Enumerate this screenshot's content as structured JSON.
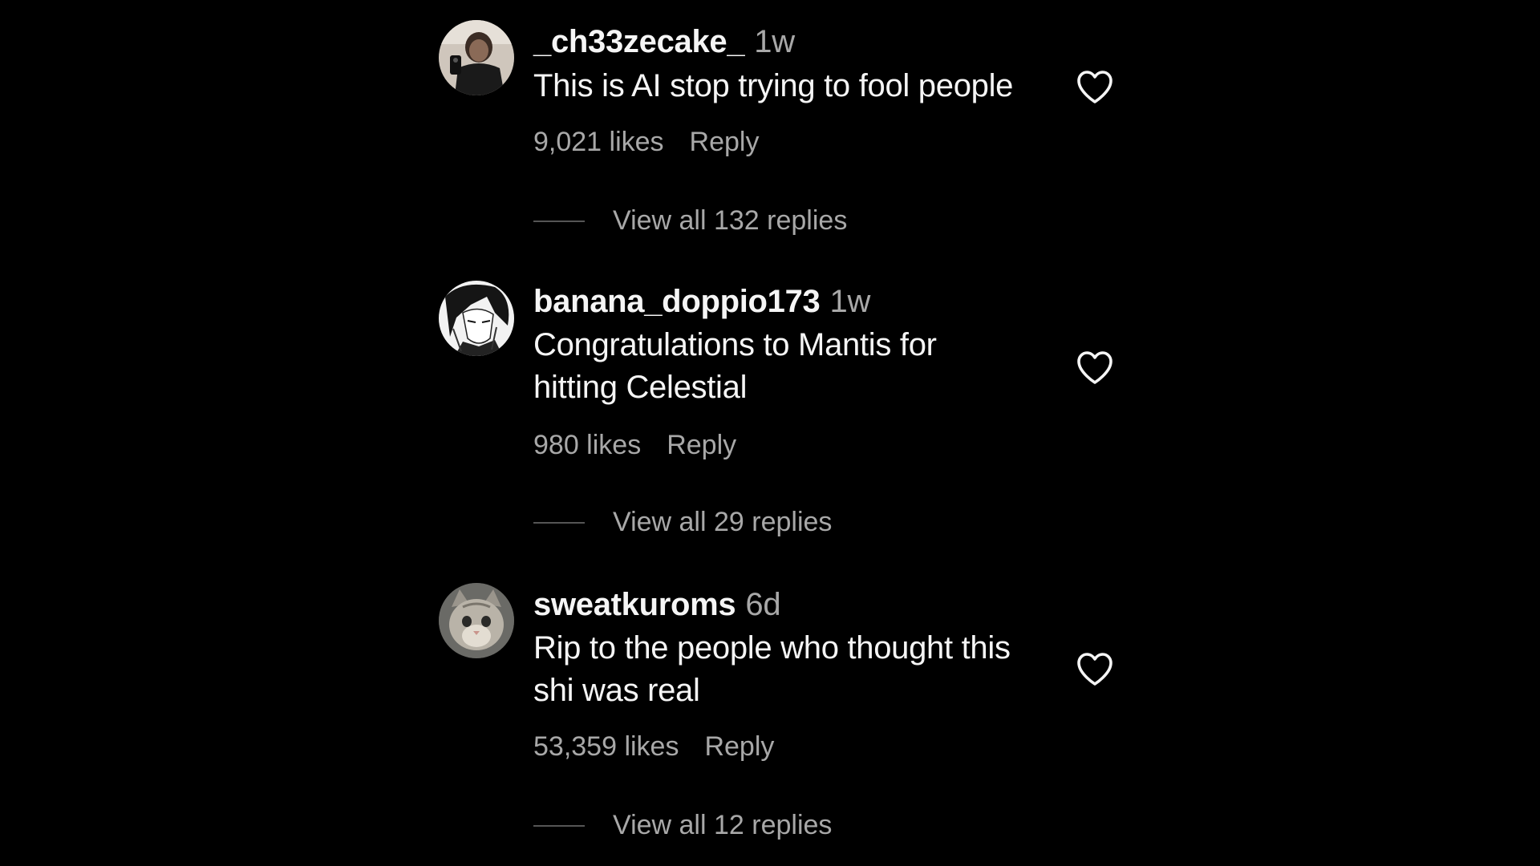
{
  "colors": {
    "background": "#000000",
    "primary_text": "#f5f5f5",
    "secondary_text": "#a8a8a8"
  },
  "comments": [
    {
      "username": "_ch33zecake_",
      "time": "1w",
      "text": "This is AI stop trying to fool people",
      "likes": "9,021 likes",
      "reply_label": "Reply",
      "view_replies": "View all 132 replies",
      "avatar_icon": "selfie-photo-avatar"
    },
    {
      "username": "banana_doppio173",
      "time": "1w",
      "text": "Congratulations to Mantis for hitting Celestial",
      "likes": "980 likes",
      "reply_label": "Reply",
      "view_replies": "View all 29 replies",
      "avatar_icon": "manga-drawing-avatar"
    },
    {
      "username": "sweatkuroms",
      "time": "6d",
      "text": "Rip to the people who thought this shi was real",
      "likes": "53,359 likes",
      "reply_label": "Reply",
      "view_replies": "View all 12 replies",
      "avatar_icon": "kitten-photo-avatar"
    }
  ],
  "icons": {
    "like": "heart-outline-icon"
  }
}
